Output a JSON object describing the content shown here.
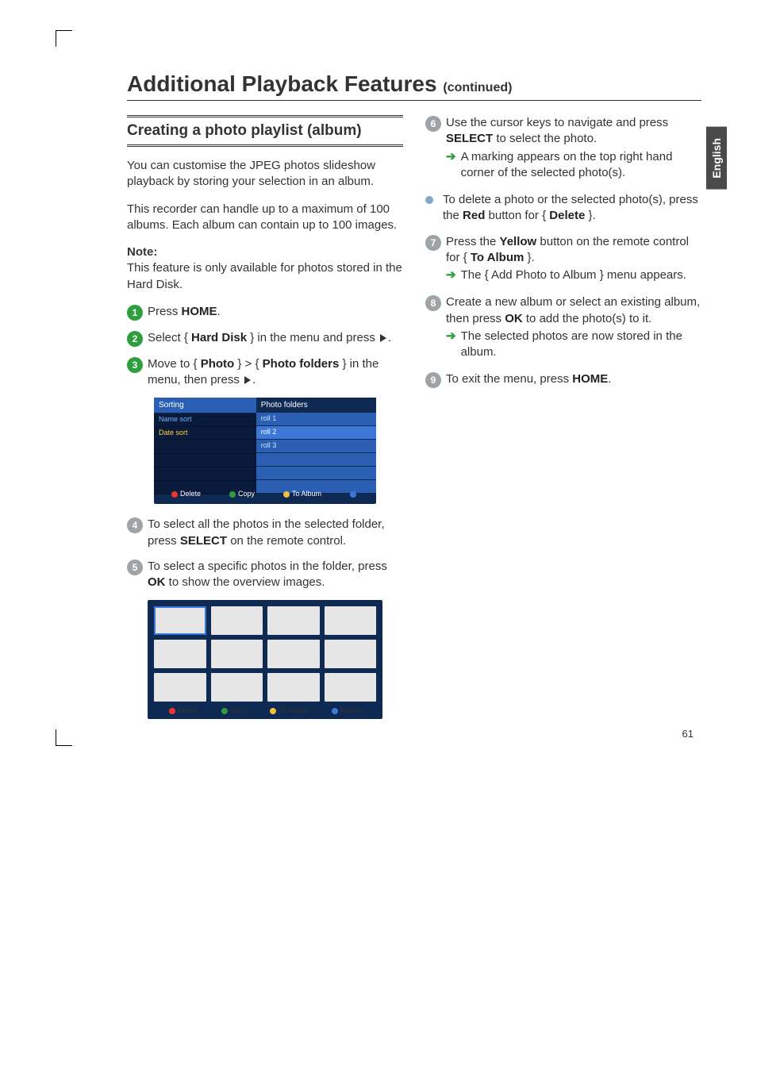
{
  "language_tab": "English",
  "page_title": "Additional Playback Features",
  "page_title_suffix": "(continued)",
  "section_heading": "Creating a photo playlist (album)",
  "intro_p1": "You can customise the JPEG photos slideshow playback by storing your selection in an album.",
  "intro_p2": "This recorder can handle up to a maximum of 100 albums.  Each album can contain up to 100 images.",
  "note_label": "Note:",
  "note_text": "This feature is only available for photos stored in the Hard Disk.",
  "steps": {
    "s1_prefix": "Press ",
    "s1_b1": "HOME",
    "s1_suffix": ".",
    "s2_prefix": "Select { ",
    "s2_b1": "Hard Disk",
    "s2_mid": " } in the menu and press ",
    "s2_suffix": ".",
    "s3_prefix": "Move to { ",
    "s3_b1": "Photo",
    "s3_mid1": " } > { ",
    "s3_b2": "Photo folders",
    "s3_mid2": " } in the menu, then press ",
    "s3_suffix": ".",
    "s4_prefix": "To select all the photos in the selected folder, press ",
    "s4_b1": "SELECT",
    "s4_suffix": " on the remote control.",
    "s5_prefix": "To select a specific photos in the folder, press ",
    "s5_b1": "OK",
    "s5_suffix": " to show the overview images.",
    "s6_prefix": "Use the cursor keys to navigate and press ",
    "s6_b1": "SELECT",
    "s6_suffix": " to select the photo.",
    "s6_arrow": "A marking appears on the top right hand corner of the selected photo(s).",
    "bullet_prefix": "To delete a photo or the selected photo(s), press the ",
    "bullet_b1": "Red",
    "bullet_mid": " button for { ",
    "bullet_b2": "Delete",
    "bullet_suffix": " }.",
    "s7_prefix": "Press the ",
    "s7_b1": "Yellow",
    "s7_mid": " button on the remote control for { ",
    "s7_b2": "To Album",
    "s7_suffix": " }.",
    "s7_arrow": "The { Add Photo to Album } menu appears.",
    "s8_prefix": "Create a new album or select an existing album, then press ",
    "s8_b1": "OK",
    "s8_suffix": " to add the photo(s) to it.",
    "s8_arrow": "The selected photos are now stored in the album.",
    "s9_prefix": "To exit the menu, press ",
    "s9_b1": "HOME",
    "s9_suffix": "."
  },
  "screenshot1": {
    "left_header": "Sorting",
    "left_rows": [
      "Name sort",
      "Date sort"
    ],
    "right_header": "Photo folders",
    "right_rows": [
      "roll 1",
      "roll 2",
      "roll 3"
    ],
    "buttons": [
      "Delete",
      "Copy",
      "To Album",
      ""
    ]
  },
  "screenshot2": {
    "buttons": [
      "Delete",
      "Copy",
      "To Album",
      "Rotate"
    ]
  },
  "page_number": "61"
}
